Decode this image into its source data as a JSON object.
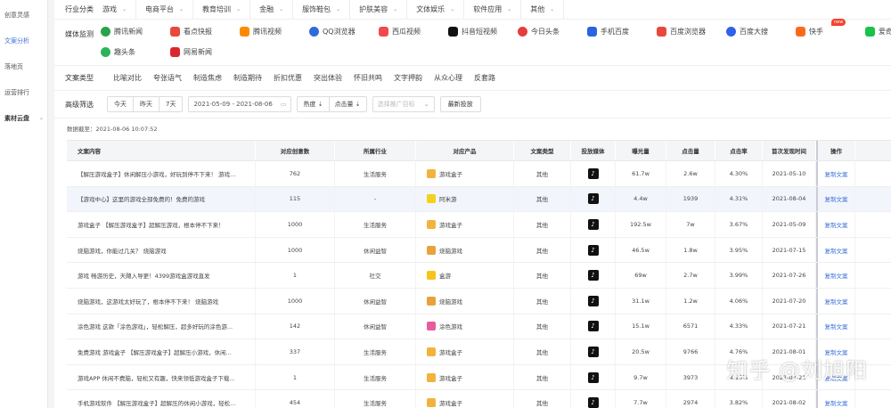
{
  "sidebar": {
    "items": [
      {
        "label": "创意灵感",
        "active": false
      },
      {
        "label": "文案分析",
        "active": true
      },
      {
        "label": "落地页",
        "active": false
      },
      {
        "label": "运营排行",
        "active": false
      },
      {
        "label": "素材云盘",
        "active": false
      }
    ]
  },
  "filters": {
    "industry_label": "行业分类",
    "industries": [
      "游戏",
      "电商平台",
      "教育培训",
      "金融",
      "服饰鞋包",
      "护肤美容",
      "文体娱乐",
      "软件应用",
      "其他"
    ],
    "media_label": "媒体监测",
    "media": [
      {
        "label": "腾讯新闻",
        "icon": "tencent-news-icon",
        "color": "#2aa14b",
        "new": false
      },
      {
        "label": "看点快报",
        "icon": "kandian-icon",
        "color": "#e8493d",
        "new": false
      },
      {
        "label": "腾讯视频",
        "icon": "tencent-video-icon",
        "color": "#ff8a00",
        "new": false
      },
      {
        "label": "QQ浏览器",
        "icon": "qq-browser-icon",
        "color": "#2f6bdb",
        "new": false
      },
      {
        "label": "西瓜视频",
        "icon": "xigua-icon",
        "color": "#f24a4a",
        "new": false
      },
      {
        "label": "抖音短视频",
        "icon": "douyin-icon",
        "color": "#111111",
        "new": false
      },
      {
        "label": "今日头条",
        "icon": "toutiao-icon",
        "color": "#e63c3c",
        "new": false
      },
      {
        "label": "手机百度",
        "icon": "baidu-mobile-icon",
        "color": "#2b63e0",
        "new": false
      },
      {
        "label": "百度浏览器",
        "icon": "baidu-browser-icon",
        "color": "#e8493d",
        "new": false
      },
      {
        "label": "百度大搜",
        "icon": "baidu-search-icon",
        "color": "#2f62e8",
        "new": false
      },
      {
        "label": "快手",
        "icon": "kuaishou-icon",
        "color": "#ff6a1a",
        "new": true
      },
      {
        "label": "爱奇艺",
        "icon": "iqiyi-icon",
        "color": "#19c24a",
        "new": true
      },
      {
        "label": "趣头条",
        "icon": "qutoutiao-icon",
        "color": "#2cb35a",
        "new": false
      },
      {
        "label": "网易新闻",
        "icon": "netease-news-icon",
        "color": "#d9272e",
        "new": false
      }
    ],
    "new_tag": "new",
    "ctype_label": "文案类型",
    "ctypes": [
      "比喻对比",
      "夸张语气",
      "制造焦虑",
      "制造期待",
      "折扣优惠",
      "突出体验",
      "怀旧共鸣",
      "文字押韵",
      "从众心理",
      "反套路"
    ],
    "adv_label": "高级筛选",
    "time_tabs": [
      "今天",
      "昨天",
      "7天"
    ],
    "date_range": "2021-05-09 - 2021-08-06",
    "sorts": [
      "热度 ⇣",
      "点击量 ⇣"
    ],
    "target_placeholder": "选择推广目标",
    "latest_btn": "最新投放"
  },
  "data_date": "数据截至：2021-08-06 10:07:52",
  "table": {
    "headers": [
      "文案内容",
      "对应创意数",
      "所属行业",
      "对应产品",
      "文案类型",
      "投放媒体",
      "曝光量",
      "点击量",
      "点击率",
      "首次发现时间",
      "操作"
    ],
    "op_label": "复制文案",
    "rows": [
      {
        "content": "【解压游戏盒子】休闲解压小游戏，好玩到停不下来！ 游戏...",
        "count": "762",
        "industry": "生活服务",
        "product": "游戏盒子",
        "product_icon": "#f2b33d",
        "ctype": "其他",
        "exposure": "61.7w",
        "clicks": "2.6w",
        "ctr": "4.30%",
        "date": "2021-05-10"
      },
      {
        "content": "【游戏中心】这里的游戏全部免费的！免费的游戏",
        "count": "115",
        "industry": "-",
        "product": "阿米游",
        "product_icon": "#f4d21a",
        "ctype": "其他",
        "exposure": "4.4w",
        "clicks": "1939",
        "ctr": "4.31%",
        "date": "2021-08-04"
      },
      {
        "content": "游戏盒子 【解压游戏盒子】超解压游戏，根本停不下来！",
        "count": "1000",
        "industry": "生活服务",
        "product": "游戏盒子",
        "product_icon": "#f2b33d",
        "ctype": "其他",
        "exposure": "192.5w",
        "clicks": "7w",
        "ctr": "3.67%",
        "date": "2021-05-09"
      },
      {
        "content": "烧脑游戏，你能过几关？ 烧脑游戏",
        "count": "1000",
        "industry": "休闲益智",
        "product": "烧脑游戏",
        "product_icon": "#e9a23b",
        "ctype": "其他",
        "exposure": "46.5w",
        "clicks": "1.8w",
        "ctr": "3.95%",
        "date": "2021-07-15"
      },
      {
        "content": "游戏 畅游历史，天飓入导更！4399游戏盒游戏直发",
        "count": "1",
        "industry": "社交",
        "product": "盒游",
        "product_icon": "#f5c518",
        "ctype": "其他",
        "exposure": "69w",
        "clicks": "2.7w",
        "ctr": "3.99%",
        "date": "2021-07-26"
      },
      {
        "content": "烧脑游戏，这游戏太好玩了，根本停不下来！ 烧脑游戏",
        "count": "1000",
        "industry": "休闲益智",
        "product": "烧脑游戏",
        "product_icon": "#e9a23b",
        "ctype": "其他",
        "exposure": "31.1w",
        "clicks": "1.2w",
        "ctr": "4.06%",
        "date": "2021-07-20"
      },
      {
        "content": "涂色游戏 这款「涂色游戏」，轻松解压，超多好玩的涂色游...",
        "count": "142",
        "industry": "休闲益智",
        "product": "涂色游戏",
        "product_icon": "#e85c9a",
        "ctype": "其他",
        "exposure": "15.1w",
        "clicks": "6571",
        "ctr": "4.33%",
        "date": "2021-07-21"
      },
      {
        "content": "免费游戏 游戏盒子 【解压游戏盒子】超解压小游戏，休闲...",
        "count": "337",
        "industry": "生活服务",
        "product": "游戏盒子",
        "product_icon": "#f2b33d",
        "ctype": "其他",
        "exposure": "20.5w",
        "clicks": "9766",
        "ctr": "4.76%",
        "date": "2021-08-01"
      },
      {
        "content": "游戏APP 休闲不费脑，轻松又有趣，快来领低游戏盒子下载...",
        "count": "1",
        "industry": "生活服务",
        "product": "游戏盒子",
        "product_icon": "#f2b33d",
        "ctype": "其他",
        "exposure": "9.7w",
        "clicks": "3973",
        "ctr": "4.10%",
        "date": "2021-07-21"
      },
      {
        "content": "手机游戏软件 【解压游戏盒子】超解压的休闲小游戏，轻松...",
        "count": "454",
        "industry": "生活服务",
        "product": "游戏盒子",
        "product_icon": "#f2b33d",
        "ctype": "其他",
        "exposure": "7.7w",
        "clicks": "2974",
        "ctr": "3.82%",
        "date": "2021-08-02"
      }
    ]
  },
  "watermark": "知乎 @刘旭阳"
}
